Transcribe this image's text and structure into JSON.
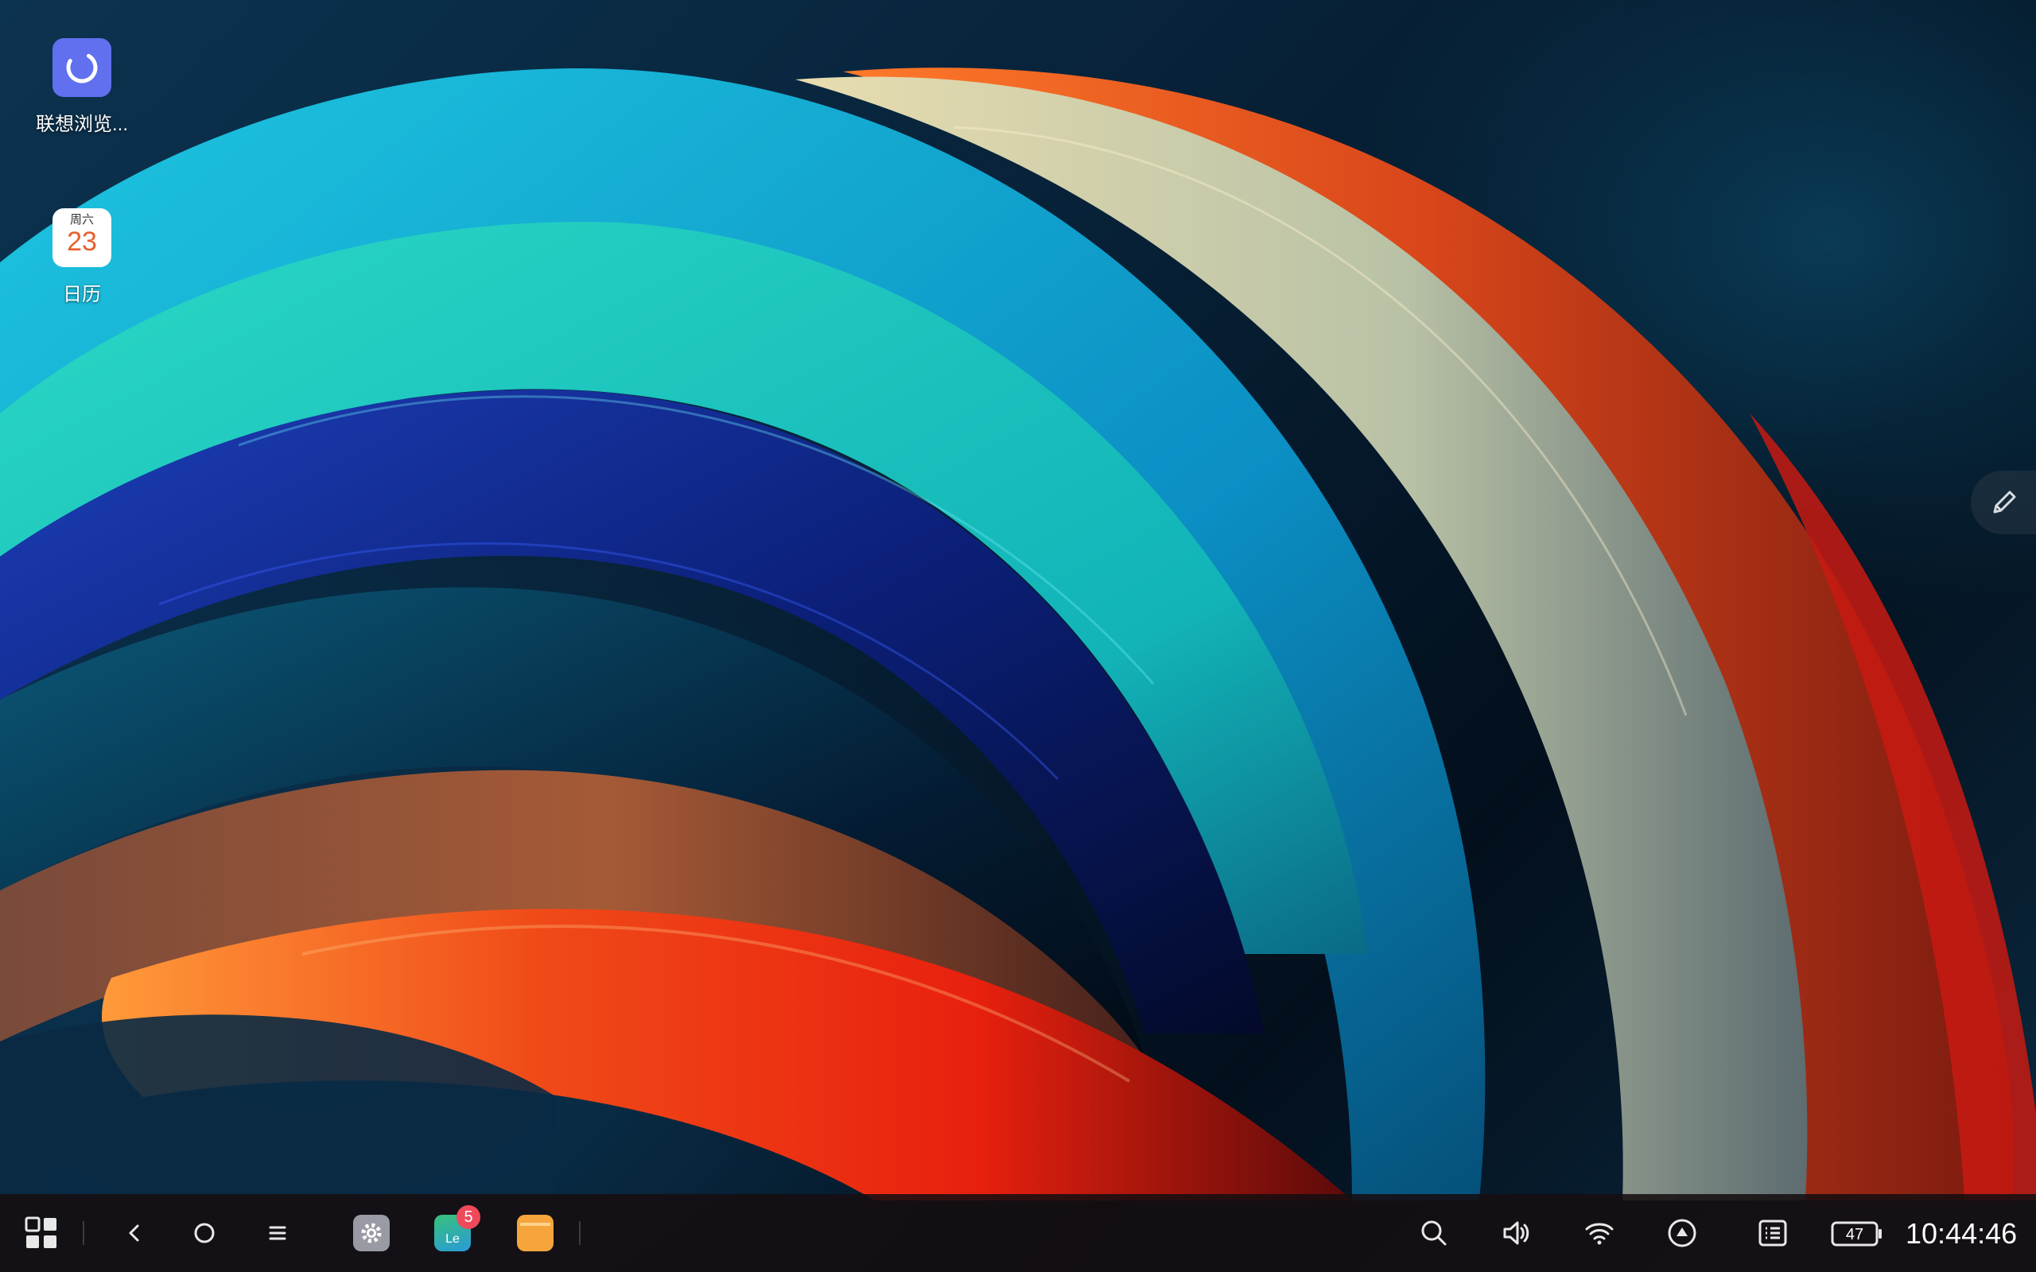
{
  "desktop": {
    "icons": [
      {
        "label": "联想浏览..."
      },
      {
        "label": "日历",
        "weekday": "周六",
        "day": "23"
      }
    ]
  },
  "taskbar": {
    "app_launcher_icon": "grid-icon",
    "nav": {
      "back_icon": "back-icon",
      "home_icon": "home-icon",
      "recents_icon": "menu-icon"
    },
    "pinned_apps": [
      {
        "icon": "settings-icon"
      },
      {
        "icon": "app-store-icon",
        "text": "Le",
        "badge": "5"
      },
      {
        "icon": "file-manager-icon"
      }
    ],
    "tray": {
      "search_icon": "search-icon",
      "volume_icon": "volume-icon",
      "wifi_icon": "wifi-icon",
      "up_icon": "upload-icon",
      "notifications_icon": "notification-list-icon",
      "battery": "47",
      "clock": "10:44:46"
    }
  },
  "edge_tool": {
    "icon": "pen-icon"
  },
  "colors": {
    "taskbar_bg": "#160e10",
    "badge": "#ef4a5a",
    "browser_tile": "#6070ee",
    "calendar_day": "#e8602c"
  }
}
